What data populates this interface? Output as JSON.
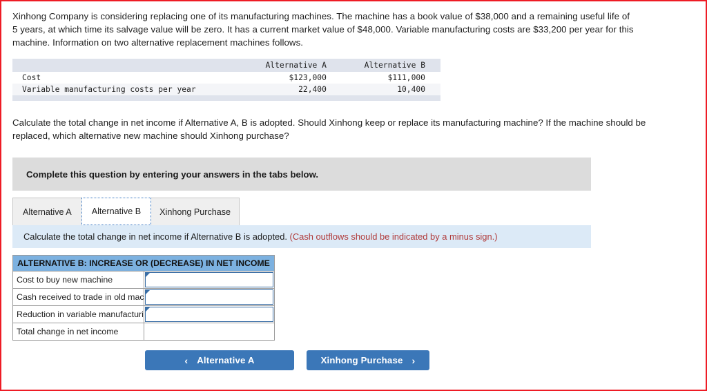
{
  "problem": {
    "statement": "Xinhong Company is considering replacing one of its manufacturing machines. The machine has a book value of $38,000 and a remaining useful life of 5 years, at which time its salvage value will be zero. It has a current market value of $48,000. Variable manufacturing costs are $33,200 per year for this machine. Information on two alternative replacement machines follows.",
    "question": "Calculate the total change in net income if Alternative A, B is adopted. Should Xinhong keep or replace its manufacturing machine? If the machine should be replaced, which alternative new machine should Xinhong purchase?"
  },
  "given_table": {
    "col_blank": "",
    "col_a": "Alternative A",
    "col_b": "Alternative B",
    "rows": [
      {
        "label": "Cost",
        "a": "$123,000",
        "b": "$111,000"
      },
      {
        "label": "Variable manufacturing costs per year",
        "a": "22,400",
        "b": "10,400"
      }
    ]
  },
  "banner": {
    "text": "Complete this question by entering your answers in the tabs below."
  },
  "tabs": [
    {
      "label": "Alternative A",
      "active": false
    },
    {
      "label": "Alternative B",
      "active": true
    },
    {
      "label": "Xinhong Purchase",
      "active": false
    }
  ],
  "instruction": {
    "main": "Calculate the total change in net income if Alternative B is adopted.",
    "hint": "(Cash outflows should be indicated by a minus sign.)"
  },
  "answer_table": {
    "header": "ALTERNATIVE B: INCREASE OR (DECREASE) IN NET INCOME",
    "rows": [
      {
        "label": "Cost to buy new machine",
        "value": "",
        "editable": true
      },
      {
        "label": "Cash received to trade in old machine",
        "value": "",
        "editable": true
      },
      {
        "label": "Reduction in variable manufacturing costs",
        "value": "",
        "editable": true
      },
      {
        "label": "Total change in net income",
        "value": "",
        "editable": false
      }
    ]
  },
  "nav": {
    "prev_label": "Alternative A",
    "prev_icon": "chevron-left",
    "prev_glyph": "‹",
    "next_label": "Xinhong Purchase",
    "next_icon": "chevron-right",
    "next_glyph": "›"
  },
  "colors": {
    "frame_red": "#ee1c25",
    "button_blue": "#3b77b8",
    "table_header_blue": "#7cb1e0",
    "strip_blue": "#dceaf7",
    "banner_grey": "#dcdcdc",
    "given_header_grey": "#dfe3ec",
    "hint_red": "#b03a3a",
    "input_border_blue": "#3a6ea5"
  }
}
